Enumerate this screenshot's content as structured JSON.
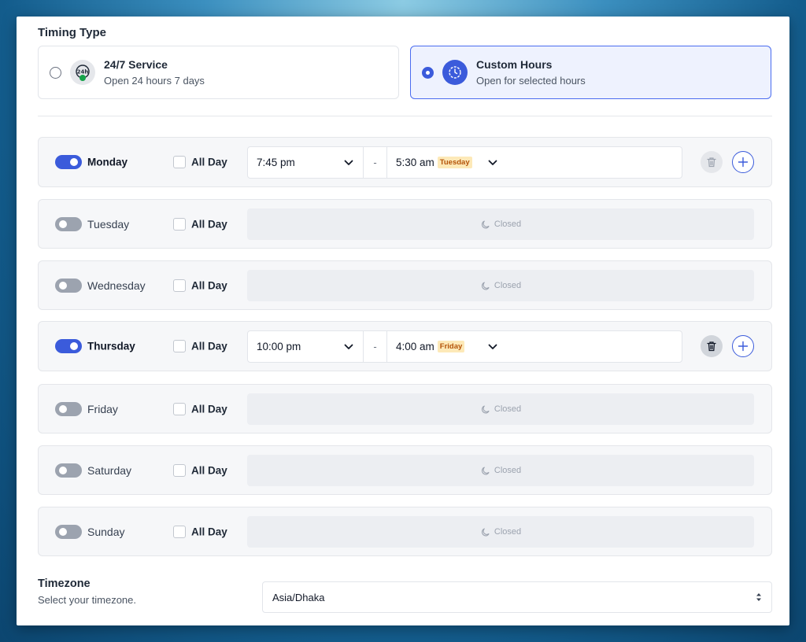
{
  "timing": {
    "title": "Timing Type",
    "options": [
      {
        "title": "24/7 Service",
        "subtitle": "Open 24 hours 7 days",
        "selected": false,
        "icon": "24h-icon"
      },
      {
        "title": "Custom Hours",
        "subtitle": "Open for selected hours",
        "selected": true,
        "icon": "clock-icon"
      }
    ]
  },
  "schedule": {
    "all_day_label": "All Day",
    "closed_label": "Closed",
    "separator": "-",
    "days": [
      {
        "name": "Monday",
        "enabled": true,
        "start": "7:45 pm",
        "end": "5:30 am",
        "end_day": "Tuesday"
      },
      {
        "name": "Tuesday",
        "enabled": false
      },
      {
        "name": "Wednesday",
        "enabled": false
      },
      {
        "name": "Thursday",
        "enabled": true,
        "start": "10:00 pm",
        "end": "4:00 am",
        "end_day": "Friday"
      },
      {
        "name": "Friday",
        "enabled": false
      },
      {
        "name": "Saturday",
        "enabled": false
      },
      {
        "name": "Sunday",
        "enabled": false
      }
    ]
  },
  "timezone": {
    "title": "Timezone",
    "subtitle": "Select your timezone.",
    "value": "Asia/Dhaka"
  },
  "colors": {
    "accent": "#3b5bdb",
    "next_day_badge_bg": "#fde9b8",
    "next_day_badge_text": "#b45309"
  }
}
